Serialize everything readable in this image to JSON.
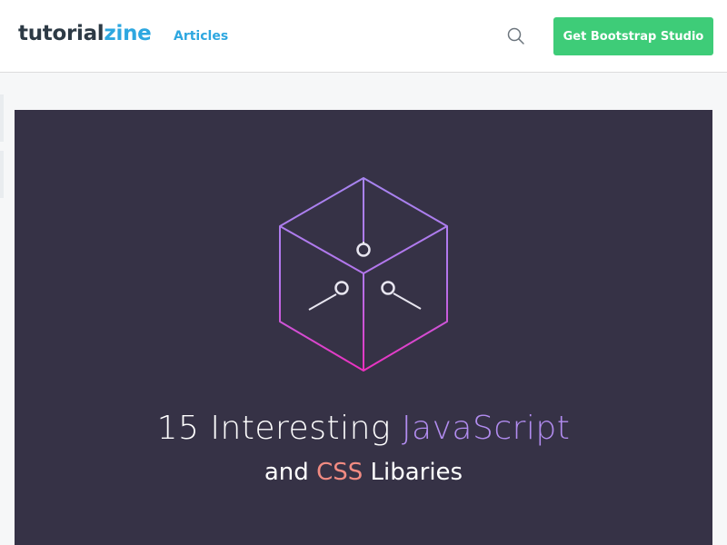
{
  "header": {
    "logo_part1": "tutorial",
    "logo_part2": "zine",
    "nav_articles": "Articles",
    "cta_label": "Get Bootstrap Studio",
    "search_icon": "search-icon"
  },
  "hero": {
    "title_line1_prefix": "15 Interesting ",
    "title_line1_highlight": "JavaScript",
    "title_line2_prefix": "and ",
    "title_line2_highlight": "CSS",
    "title_line2_suffix": " Libaries",
    "graphic_icon": "cube-icon"
  },
  "colors": {
    "brand_dark": "#2d3a45",
    "brand_blue": "#2da7e0",
    "cta_green": "#3ecc78",
    "hero_bg": "#363246",
    "highlight_purple": "#b28cf0",
    "highlight_coral": "#f28b82"
  }
}
